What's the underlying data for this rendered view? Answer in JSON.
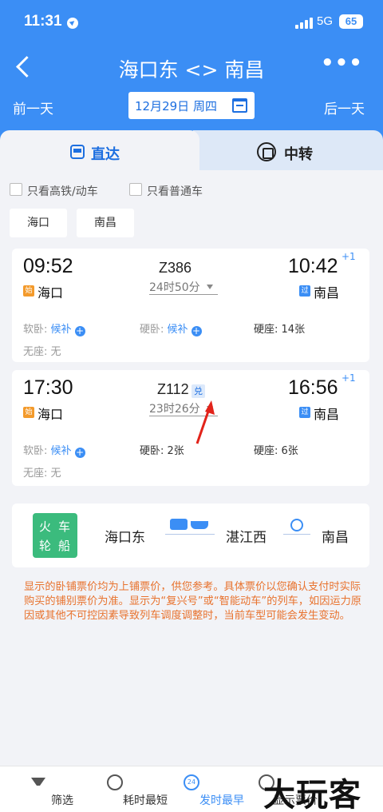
{
  "status_bar": {
    "time": "11:31",
    "network": "5G",
    "battery": "65"
  },
  "nav": {
    "title": "海口东 <> 南昌",
    "more": "•••"
  },
  "date_bar": {
    "prev": "前一天",
    "date": "12月29日 周四",
    "next": "后一天"
  },
  "tabs": [
    {
      "label": "直达"
    },
    {
      "label": "中转"
    }
  ],
  "filters": {
    "checkboxes": [
      "只看高铁/动车",
      "只看普通车"
    ],
    "station_chips": [
      "海口",
      "南昌"
    ]
  },
  "trains": [
    {
      "dep_time": "09:52",
      "arr_time": "10:42",
      "day_offset": "+1",
      "train_no": "Z386",
      "duration": "24时50分",
      "dep_station": "海口",
      "arr_station": "南昌",
      "dep_badge": "始",
      "arr_badge": "过",
      "seats": [
        {
          "name": "软卧:",
          "value": "候补",
          "add": true
        },
        {
          "name": "硬卧:",
          "value": "候补",
          "add": true
        },
        {
          "name": "硬座:",
          "value": "14张",
          "add": false
        },
        {
          "name": "无座:",
          "value": "无",
          "add": false
        }
      ]
    },
    {
      "dep_time": "17:30",
      "arr_time": "16:56",
      "day_offset": "+1",
      "train_no": "Z112",
      "exchange_badge": "兑",
      "duration": "23时26分",
      "dep_station": "海口",
      "arr_station": "南昌",
      "dep_badge": "始",
      "arr_badge": "过",
      "seats": [
        {
          "name": "软卧:",
          "value": "候补",
          "add": true
        },
        {
          "name": "硬卧:",
          "value": "2张",
          "add": false
        },
        {
          "name": "硬座:",
          "value": "6张",
          "add": false
        },
        {
          "name": "无座:",
          "value": "无",
          "add": false
        }
      ]
    }
  ],
  "route_card": {
    "logo": [
      "火",
      "车",
      "轮",
      "船"
    ],
    "from": "海口东",
    "via": "湛江西",
    "to": "南昌"
  },
  "notice": "显示的卧铺票价均为上铺票价，供您参考。具体票价以您确认支付时实际购买的铺别票价为准。显示为“复兴号”或“智能动车”的列车，如因运力原因或其他不可控因素导致列车调度调整时，当前车型可能会发生变动。",
  "bottom_bar": {
    "items": [
      "筛选",
      "耗时最短",
      "发时最早",
      "显示票价"
    ],
    "clock24_text": "24"
  },
  "watermark": "大玩客",
  "colors": {
    "header": "#3b8ef5",
    "accent": "#1d6fe0",
    "notice": "#e8732f",
    "logo_green": "#3bbb7d",
    "start_badge": "#f39a2b"
  }
}
